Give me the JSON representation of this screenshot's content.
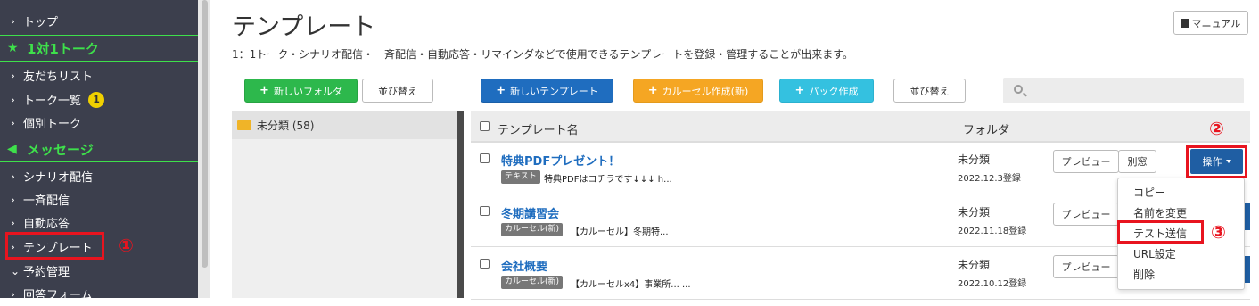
{
  "sidebar": {
    "items": [
      {
        "label": "トップ"
      },
      {
        "label": "友だちリスト"
      },
      {
        "label": "トーク一覧",
        "badge": "1"
      },
      {
        "label": "個別トーク"
      },
      {
        "label": "シナリオ配信"
      },
      {
        "label": "一斉配信"
      },
      {
        "label": "自動応答"
      },
      {
        "label": "テンプレート"
      },
      {
        "label": "予約管理"
      },
      {
        "label": "回答フォーム"
      }
    ],
    "sections": [
      {
        "label": "1対1トーク",
        "icon": "star-icon"
      },
      {
        "label": "メッセージ",
        "icon": "megaphone-icon"
      }
    ]
  },
  "annotations": {
    "circle1": "①",
    "circle2": "②",
    "circle3": "③"
  },
  "page": {
    "title": "テンプレート",
    "manual_label": "マニュアル",
    "description": "1：1トーク・シナリオ配信・一斉配信・自動応答・リマインダなどで使用できるテンプレートを登録・管理することが出来ます。"
  },
  "toolbar": {
    "new_folder": "新しいフォルダ",
    "sort_left": "並び替え",
    "new_template": "新しいテンプレート",
    "carousel": "カルーセル作成(新)",
    "pack": "パック作成",
    "sort_right": "並び替え",
    "search_placeholder": ""
  },
  "folders": [
    {
      "label": "未分類 (58)"
    }
  ],
  "table": {
    "headers": {
      "name": "テンプレート名",
      "folder": "フォルダ"
    },
    "rows": [
      {
        "title": "特典PDFプレゼント！",
        "tag": "テキスト",
        "snippet": "特典PDFはコチラです↓↓↓ h...",
        "folder": "未分類",
        "date": "2022.12.3登録",
        "preview": "プレビュー",
        "copy": "別窓"
      },
      {
        "title": "冬期講習会",
        "tag": "カルーセル(新)",
        "snippet": "【カルーセル】冬期特...",
        "folder": "未分類",
        "date": "2022.11.18登録",
        "preview": "プレビュー"
      },
      {
        "title": "会社概要",
        "tag": "カルーセル(新)",
        "snippet": "【カルーセルx4】事業所... ...",
        "folder": "未分類",
        "date": "2022.10.12登録",
        "preview": "プレビュー"
      }
    ],
    "operation_label": "操作"
  },
  "dropdown": {
    "items": [
      "コピー",
      "名前を変更",
      "テスト送信",
      "URL設定",
      "削除"
    ]
  },
  "colors": {
    "sidebar_bg": "#3c3f4d",
    "section_green": "#3ee04b",
    "highlight_red": "#e8141f",
    "link_blue": "#1f6dbf"
  }
}
